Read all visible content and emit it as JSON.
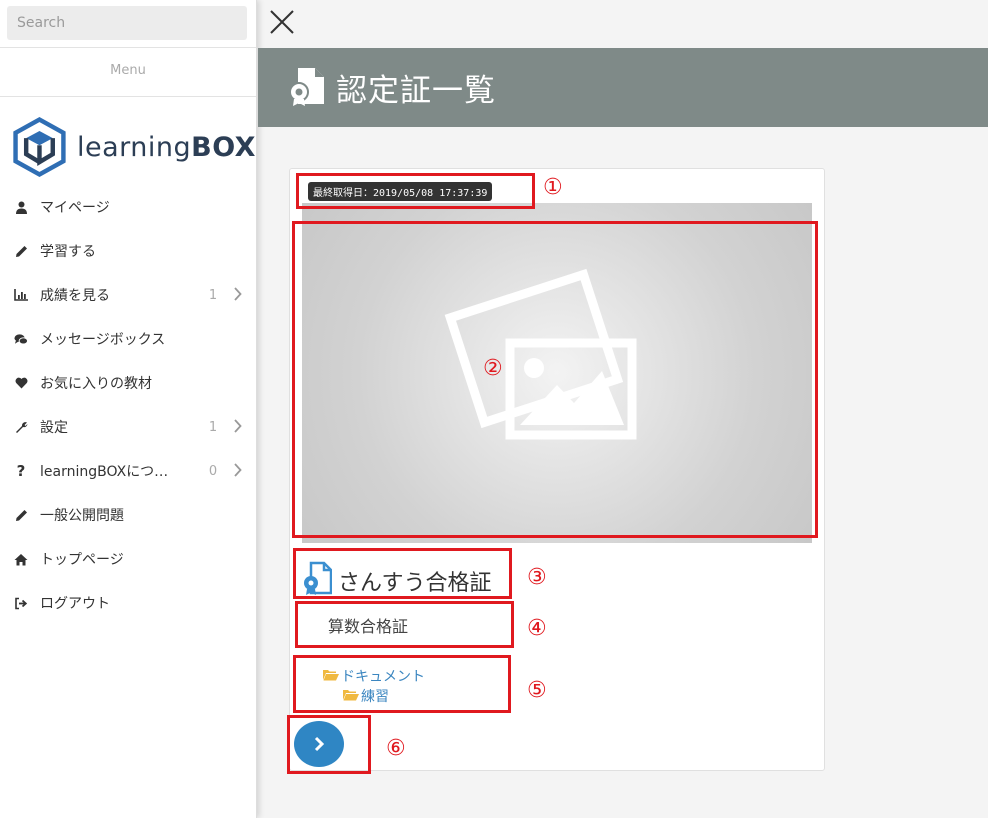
{
  "sidebar": {
    "search_placeholder": "Search",
    "menu_label": "Menu",
    "logo_text_bold": "learning",
    "logo_text_box": "BOX",
    "items": [
      {
        "label": "マイページ",
        "icon": "user-icon",
        "count": "",
        "chevron": false
      },
      {
        "label": "学習する",
        "icon": "pencil-icon",
        "count": "",
        "chevron": false
      },
      {
        "label": "成績を見る",
        "icon": "bar-chart-icon",
        "count": "1",
        "chevron": true
      },
      {
        "label": "メッセージボックス",
        "icon": "comments-icon",
        "count": "",
        "chevron": false
      },
      {
        "label": "お気に入りの教材",
        "icon": "heart-icon",
        "count": "",
        "chevron": false
      },
      {
        "label": "設定",
        "icon": "wrench-icon",
        "count": "1",
        "chevron": true
      },
      {
        "label": "learningBOXにつ…",
        "icon": "question-icon",
        "count": "0",
        "chevron": true
      },
      {
        "label": "一般公開問題",
        "icon": "pencil-icon",
        "count": "",
        "chevron": false
      },
      {
        "label": "トップページ",
        "icon": "home-icon",
        "count": "",
        "chevron": false
      },
      {
        "label": "ログアウト",
        "icon": "sign-out-icon",
        "count": "",
        "chevron": false
      }
    ]
  },
  "header": {
    "title": "認定証一覧"
  },
  "card": {
    "date_badge": "最終取得日：2019/05/08 17:37:39",
    "title": "さんすう合格証",
    "subtitle": "算数合格証",
    "folder_parent": "ドキュメント",
    "folder_child": "練習"
  },
  "annotations": [
    "①",
    "②",
    "③",
    "④",
    "⑤",
    "⑥"
  ],
  "colors": {
    "header_bg": "#7f8a88",
    "annotation": "#e0191f",
    "button": "#2f86c4",
    "link": "#3b86c0",
    "folder": "#f0b940"
  }
}
